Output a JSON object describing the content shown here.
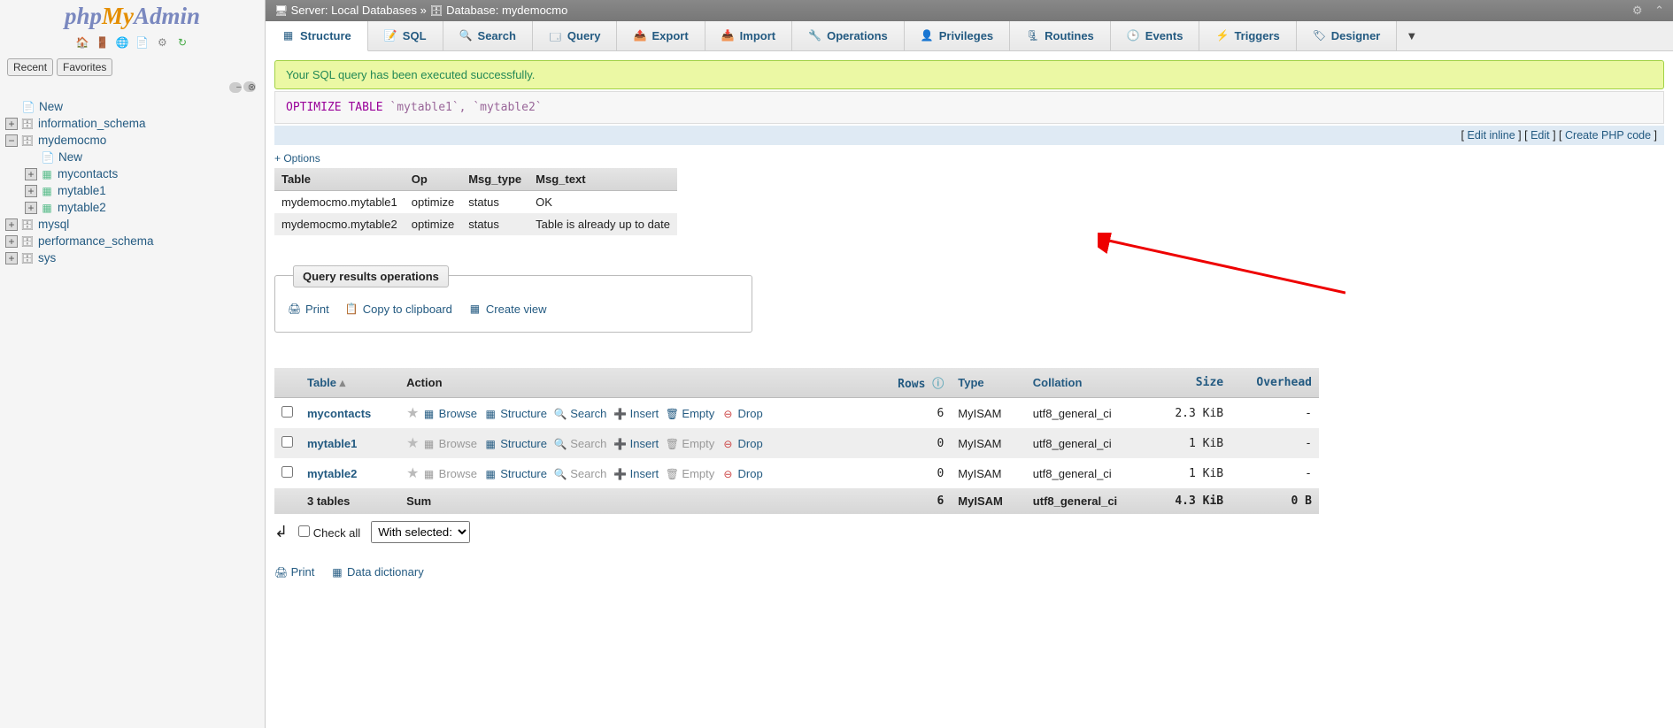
{
  "logo": {
    "php": "php",
    "my": "My",
    "admin": "Admin"
  },
  "recent": "Recent",
  "favorites": "Favorites",
  "tree": {
    "new": "New",
    "infoschema": "information_schema",
    "mydemo": "mydemocmo",
    "mydemo_new": "New",
    "mycontacts": "mycontacts",
    "mytable1": "mytable1",
    "mytable2": "mytable2",
    "mysql": "mysql",
    "perfschema": "performance_schema",
    "sys": "sys"
  },
  "breadcrumb": {
    "server_lbl": "Server: Local Databases",
    "sep": " » ",
    "db_lbl": "Database: ",
    "db_name": "mydemocmo"
  },
  "tabs": {
    "structure": "Structure",
    "sql": "SQL",
    "search": "Search",
    "query": "Query",
    "export": "Export",
    "import": "Import",
    "operations": "Operations",
    "privileges": "Privileges",
    "routines": "Routines",
    "events": "Events",
    "triggers": "Triggers",
    "designer": "Designer",
    "more": "▼"
  },
  "success": "Your SQL query has been executed successfully.",
  "sql": {
    "kw": "OPTIMIZE TABLE",
    "rest": " `mytable1`, `mytable2`"
  },
  "sql_links": {
    "inline": "Edit inline",
    "edit": "Edit",
    "php": "Create PHP code"
  },
  "options": "+ Options",
  "result_head": {
    "table": "Table",
    "op": "Op",
    "msgtype": "Msg_type",
    "msgtext": "Msg_text"
  },
  "result_rows": [
    {
      "table": "mydemocmo.mytable1",
      "op": "optimize",
      "type": "status",
      "text": "OK"
    },
    {
      "table": "mydemocmo.mytable2",
      "op": "optimize",
      "type": "status",
      "text": "Table is already up to date"
    }
  ],
  "ops": {
    "legend": "Query results operations",
    "print": "Print",
    "copy": "Copy to clipboard",
    "view": "Create view"
  },
  "list_head": {
    "table": "Table",
    "action": "Action",
    "rows": "Rows",
    "type": "Type",
    "collation": "Collation",
    "size": "Size",
    "overhead": "Overhead"
  },
  "list_actions": {
    "browse": "Browse",
    "structure": "Structure",
    "search": "Search",
    "insert": "Insert",
    "empty": "Empty",
    "drop": "Drop"
  },
  "list_rows": [
    {
      "name": "mycontacts",
      "rows": "6",
      "type": "MyISAM",
      "coll": "utf8_general_ci",
      "size": "2.3 KiB",
      "over": "-",
      "active": true
    },
    {
      "name": "mytable1",
      "rows": "0",
      "type": "MyISAM",
      "coll": "utf8_general_ci",
      "size": "1 KiB",
      "over": "-",
      "active": false
    },
    {
      "name": "mytable2",
      "rows": "0",
      "type": "MyISAM",
      "coll": "utf8_general_ci",
      "size": "1 KiB",
      "over": "-",
      "active": false
    }
  ],
  "list_foot": {
    "tables": "3 tables",
    "sum": "Sum",
    "rows": "6",
    "type": "MyISAM",
    "coll": "utf8_general_ci",
    "size": "4.3 KiB",
    "over": "0 B"
  },
  "bottom": {
    "checkall": "Check all",
    "withsel": "With selected:"
  },
  "footer": {
    "print": "Print",
    "dd": "Data dictionary"
  }
}
